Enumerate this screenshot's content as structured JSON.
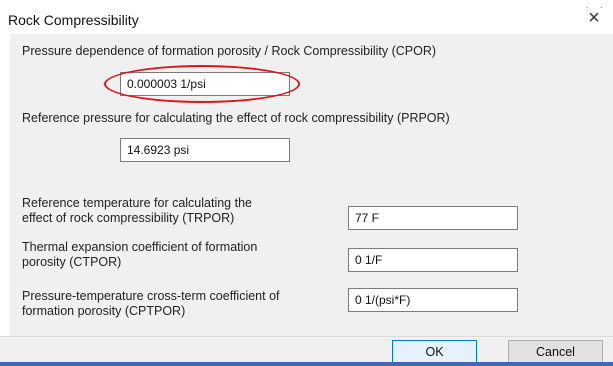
{
  "window": {
    "title": "Rock Compressibility",
    "close_symbol": "×",
    "top_dots": "·  ·"
  },
  "cpor": {
    "label": "Pressure dependence of formation porosity / Rock Compressibility (CPOR)",
    "value": "0.000003  1/psi",
    "highlight_color": "#d9171d"
  },
  "prpor": {
    "label": "Reference pressure for calculating the effect of rock compressibility (PRPOR)",
    "value": "14.6923  psi"
  },
  "trpor": {
    "label_line1": "Reference temperature for calculating the",
    "label_line2": "effect of rock compressibility (TRPOR)",
    "value": "77  F"
  },
  "ctpor": {
    "label_line1": "Thermal expansion coefficient of formation",
    "label_line2": "porosity (CTPOR)",
    "value": "0  1/F"
  },
  "cptpor": {
    "label_line1": "Pressure-temperature cross-term coefficient of",
    "label_line2": "formation porosity (CPTPOR)",
    "value": "0  1/(psi*F)"
  },
  "buttons": {
    "ok": "OK",
    "cancel": "Cancel"
  },
  "colors": {
    "accent": "#0078d7",
    "taskbar": "#3c6ab5"
  }
}
